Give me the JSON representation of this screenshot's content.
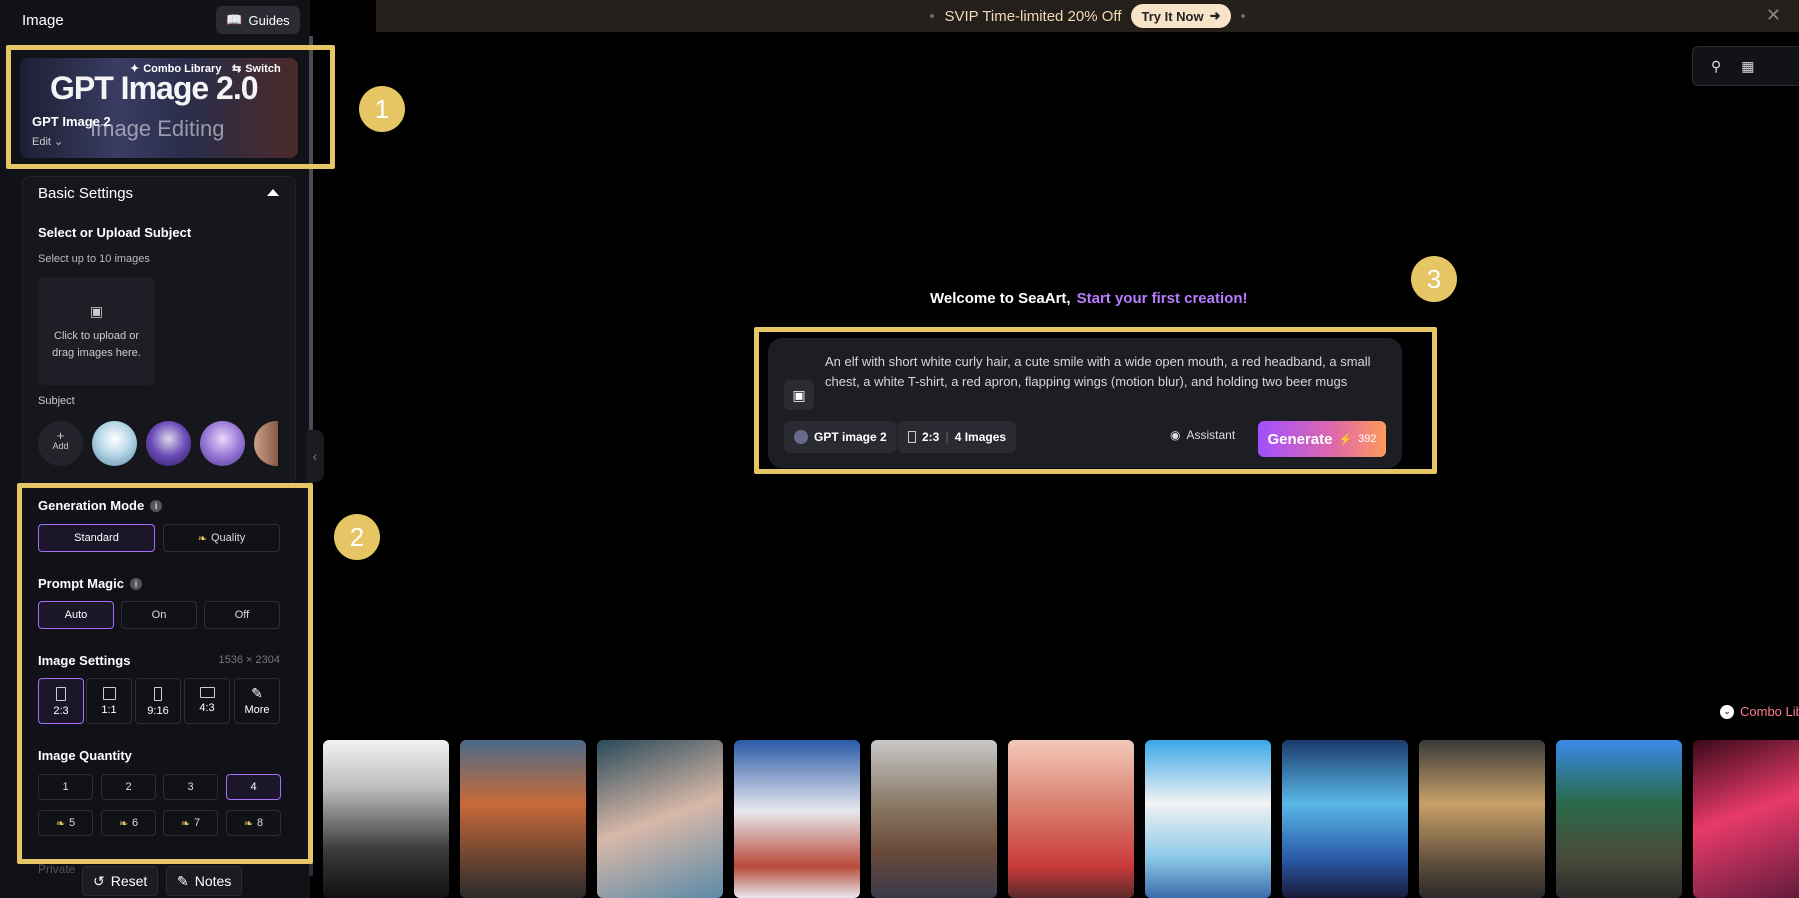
{
  "sidebar": {
    "title": "Image",
    "guides_label": "Guides",
    "model_card": {
      "banner_title": "GPT Image 2.0",
      "banner_subtitle": "Image Editing",
      "name": "GPT Image 2",
      "mode": "Edit",
      "combo_library": "Combo Library",
      "switch": "Switch"
    },
    "basic_settings": {
      "title": "Basic Settings",
      "section": "Select or Upload Subject",
      "hint": "Select up to 10 images",
      "upload_text": "Click to upload or drag images here.",
      "subject_label": "Subject",
      "add_label": "Add"
    },
    "generation_mode": {
      "label": "Generation Mode",
      "options": [
        "Standard",
        "Quality"
      ],
      "selected": "Standard"
    },
    "prompt_magic": {
      "label": "Prompt Magic",
      "options": [
        "Auto",
        "On",
        "Off"
      ],
      "selected": "Auto"
    },
    "image_settings": {
      "label": "Image Settings",
      "dimensions": "1536 × 2304",
      "ratios": [
        "2:3",
        "1:1",
        "9:16",
        "4:3",
        "More"
      ],
      "selected": "2:3"
    },
    "image_quantity": {
      "label": "Image Quantity",
      "options": [
        "1",
        "2",
        "3",
        "4",
        "5",
        "6",
        "7",
        "8"
      ],
      "selected": "4"
    },
    "private_label": "Private",
    "reset_label": "Reset",
    "notes_label": "Notes"
  },
  "banner": {
    "text": "SVIP Time-limited 20% Off",
    "cta": "Try It Now"
  },
  "main": {
    "welcome": "Welcome to SeaArt,",
    "welcome_accent": "Start your first creation!",
    "prompt_text": "An elf with short white curly hair, a cute smile with a wide open mouth, a red headband, a small chest, a white T-shirt, a red apron, flapping wings (motion blur), and holding two beer mugs",
    "model_chip": "GPT image 2",
    "ratio_chip": "2:3",
    "count_chip": "4 Images",
    "assistant_label": "Assistant",
    "generate_label": "Generate",
    "generate_cost": "392",
    "combo_library_link": "Combo Library"
  },
  "annotations": [
    "1",
    "2",
    "3"
  ],
  "colors": {
    "accent": "#a86cff",
    "highlight": "#e6c565",
    "generate_start": "#a04fff",
    "generate_end": "#ff9a5a"
  }
}
